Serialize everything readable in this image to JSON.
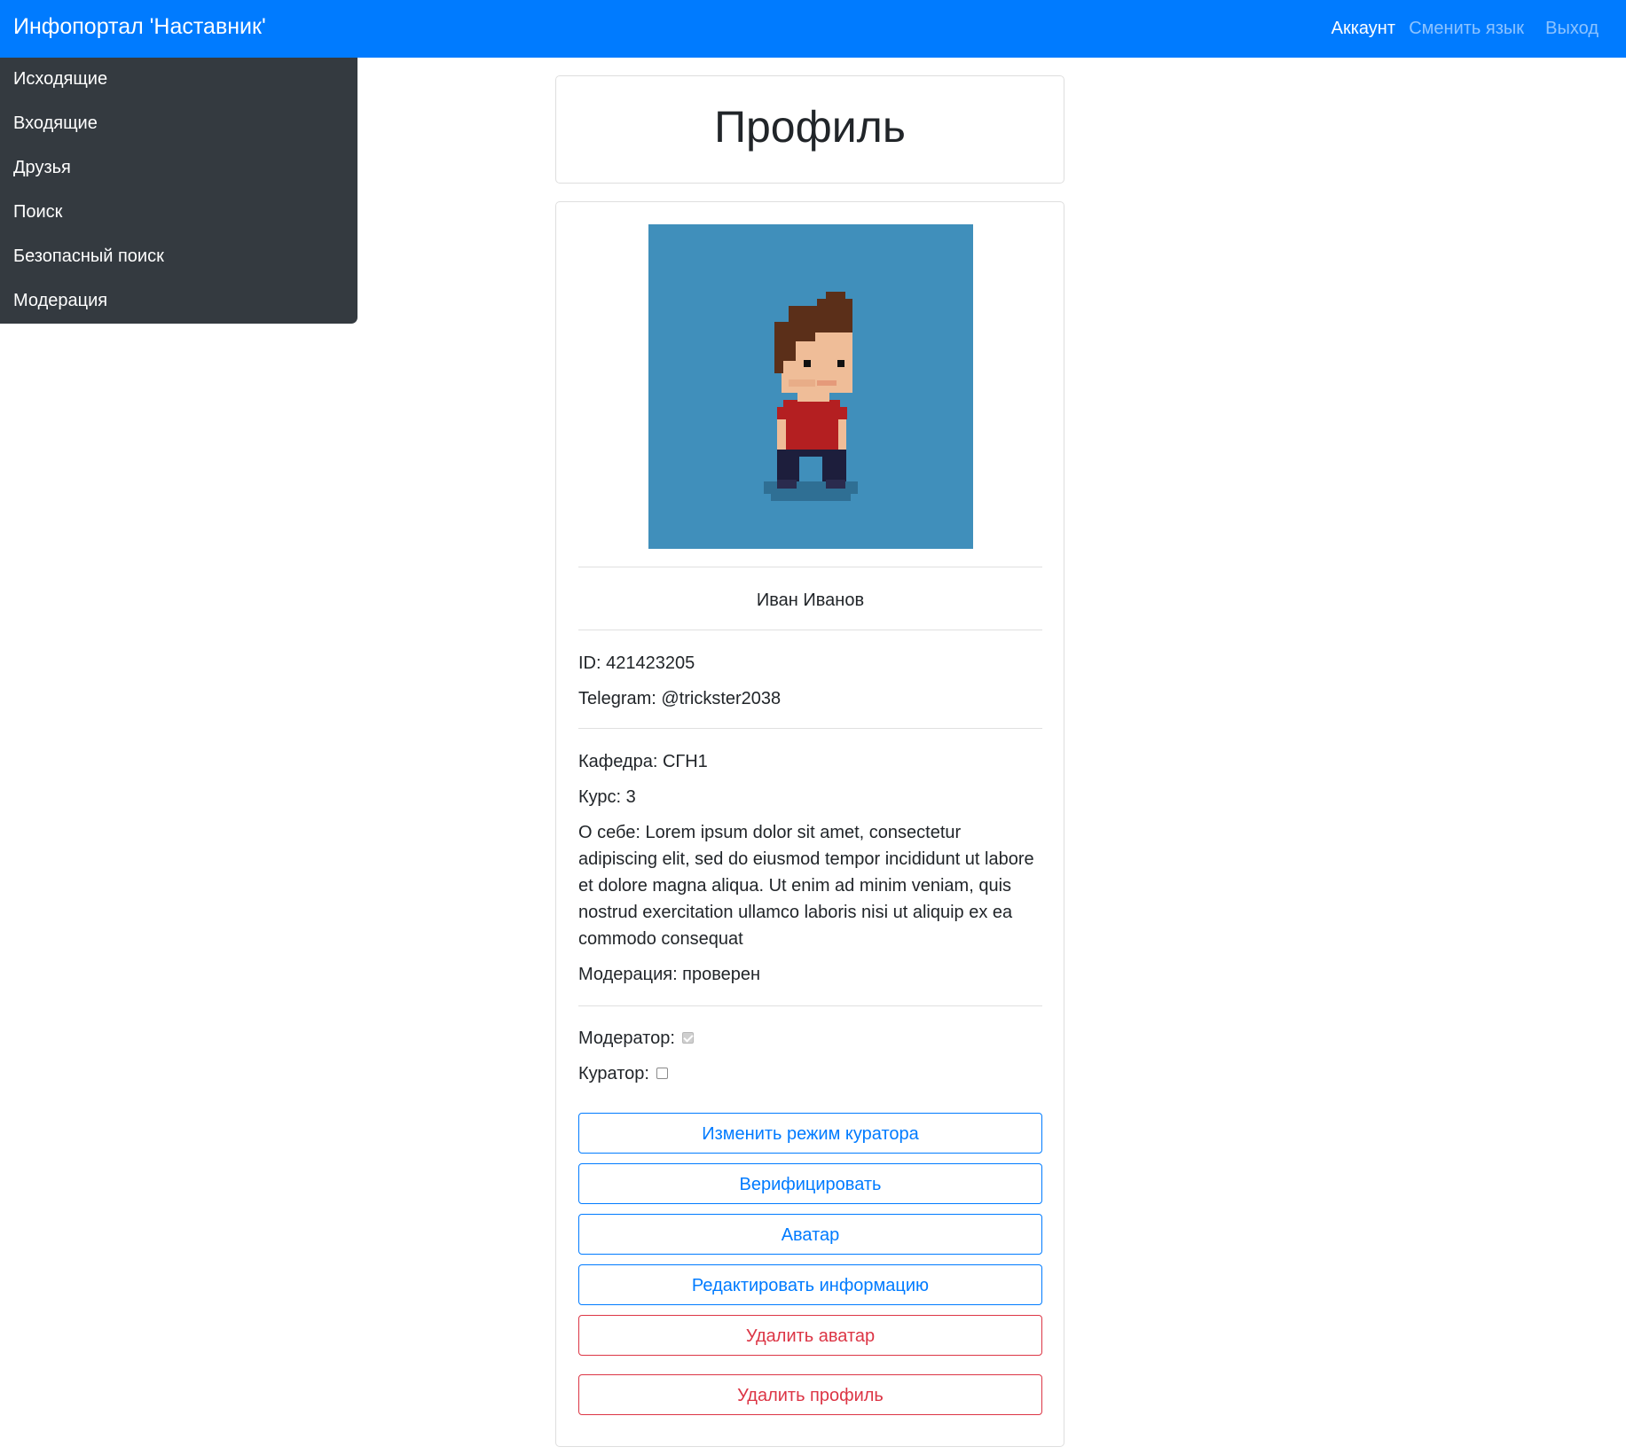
{
  "navbar": {
    "brand": "Инфопортал 'Наставник'",
    "links": [
      {
        "label": "Аккаунт",
        "active": true
      },
      {
        "label": "Сменить язык",
        "active": false
      },
      {
        "label": "Выход",
        "active": false
      }
    ],
    "color": "#007bff"
  },
  "sidebar": {
    "items": [
      {
        "label": "Исходящие"
      },
      {
        "label": "Входящие"
      },
      {
        "label": "Друзья"
      },
      {
        "label": "Поиск"
      },
      {
        "label": "Безопасный поиск"
      },
      {
        "label": "Модерация"
      }
    ],
    "color": "#343a40"
  },
  "page": {
    "title": "Профиль"
  },
  "profile": {
    "avatar_icon": "pixel-person-avatar",
    "name": "Иван Иванов",
    "id_line": "ID: 421423205",
    "telegram_line": "Telegram: @trickster2038",
    "department_line": "Кафедра: СГН1",
    "course_line": "Курс: 3",
    "about_line": "О себе: Lorem ipsum dolor sit amet, consectetur adipiscing elit, sed do eiusmod tempor incididunt ut labore et dolore magna aliqua. Ut enim ad minim veniam, quis nostrud exercitation ullamco laboris nisi ut aliquip ex ea commodo consequat",
    "moderation_line": "Модерация: проверен",
    "moderator_label": "Модератор:",
    "moderator_checked": true,
    "curator_label": "Куратор:",
    "curator_checked": false
  },
  "actions": {
    "toggle_curator": "Изменить режим куратора",
    "verify": "Верифицировать",
    "avatar": "Аватар",
    "edit_info": "Редактировать информацию",
    "delete_avatar": "Удалить аватар",
    "delete_profile": "Удалить профиль"
  },
  "colors": {
    "primary": "#007bff",
    "danger": "#dc3545",
    "avatar_bg": "#408fbb"
  }
}
